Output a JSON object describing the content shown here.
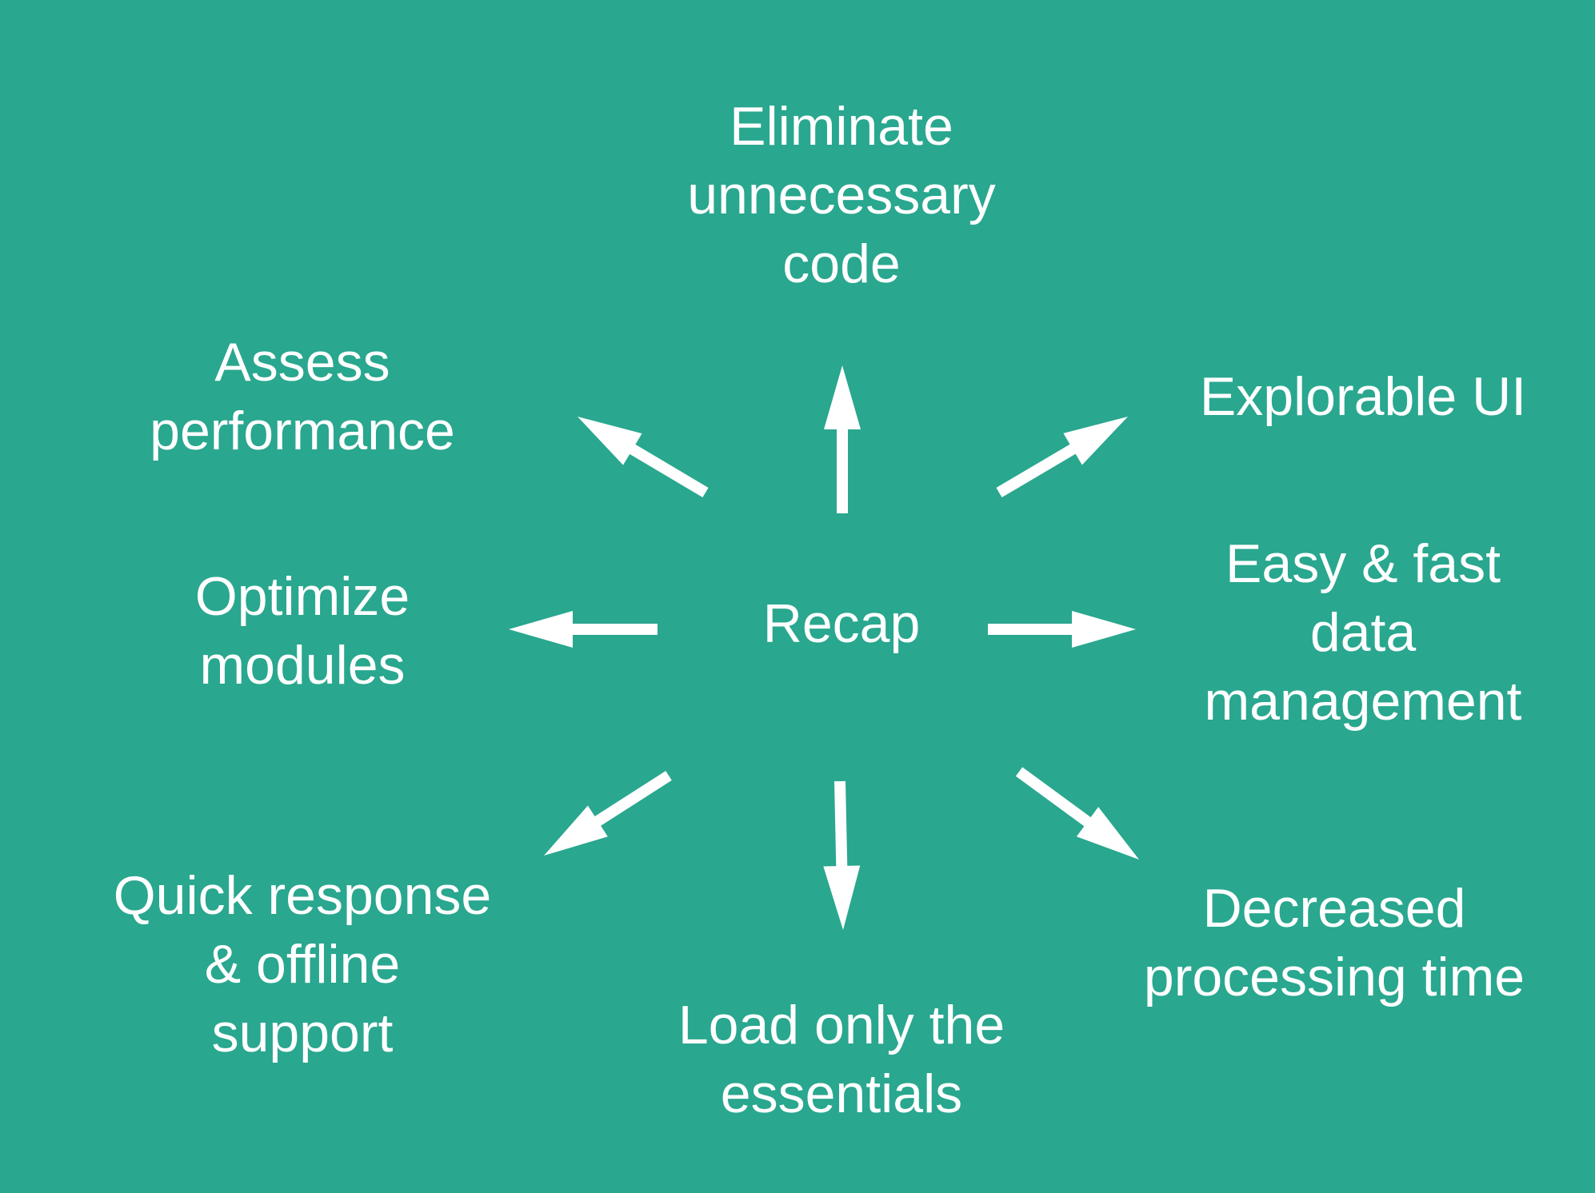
{
  "center": {
    "label": "Recap"
  },
  "nodes": [
    {
      "id": "eliminate",
      "lines": [
        "Eliminate",
        "unnecessary",
        "code"
      ]
    },
    {
      "id": "explorable",
      "lines": [
        "Explorable UI"
      ]
    },
    {
      "id": "data-management",
      "lines": [
        "Easy & fast",
        "data",
        "management"
      ]
    },
    {
      "id": "processing",
      "lines": [
        "Decreased",
        "processing time"
      ]
    },
    {
      "id": "load-essentials",
      "lines": [
        "Load only the",
        "essentials"
      ]
    },
    {
      "id": "quick-response",
      "lines": [
        "Quick response",
        "& offline",
        "support"
      ]
    },
    {
      "id": "optimize",
      "lines": [
        "Optimize",
        "modules"
      ]
    },
    {
      "id": "assess",
      "lines": [
        "Assess",
        "performance"
      ]
    }
  ],
  "colors": {
    "background": "#29a78f",
    "foreground": "#ffffff"
  }
}
